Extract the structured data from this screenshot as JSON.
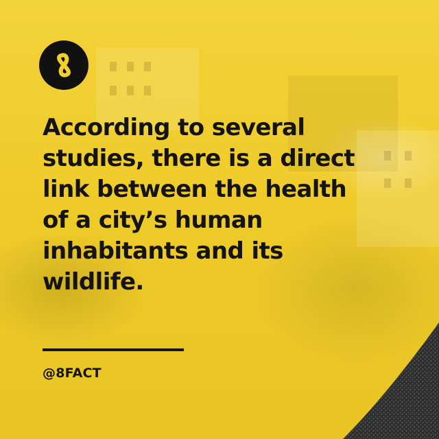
{
  "post": {
    "logo_icon": "infinity-8-icon",
    "headline": "According to several\nstudies, there is a direct\nlink between the health\nof a city’s human\ninhabitants and its\nwildlife.",
    "handle": "@8FACT"
  },
  "colors": {
    "background_yellow": "#f2cf2e",
    "text": "#141414",
    "logo_circle": "#111111",
    "logo_mark": "#f2cf2e",
    "swoosh_dark": "#2b2b2b"
  }
}
